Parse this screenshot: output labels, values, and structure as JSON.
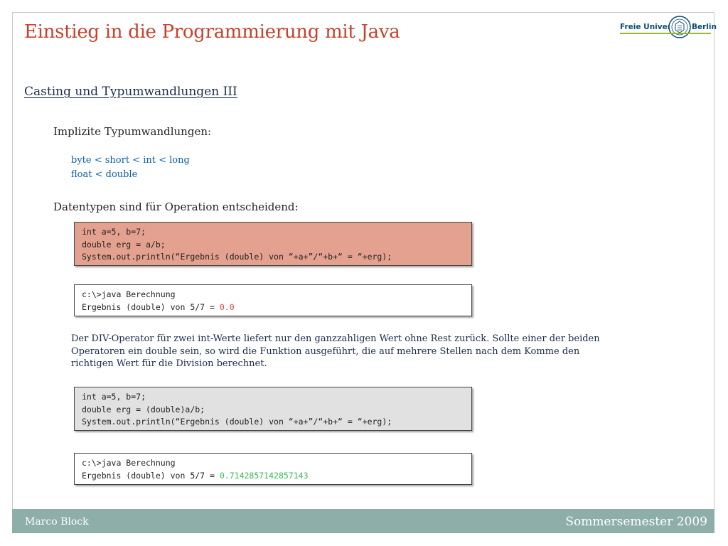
{
  "header": {
    "title": "Einstieg in die Programmierung mit Java",
    "logo_left": "Freie Universität",
    "logo_right": "Berlin"
  },
  "subtitle": "Casting und Typumwandlungen III",
  "section1": {
    "label": "Implizite Typumwandlungen:",
    "lines": [
      "byte < short < int < long",
      "float < double"
    ]
  },
  "section2": {
    "label": "Datentypen sind für Operation entscheidend:"
  },
  "code1": {
    "lines": [
      "int a=5, b=7;",
      "double erg = a/b;",
      "System.out.println(“Ergebnis (double) von “+a+”/“+b+“ = “+erg);"
    ]
  },
  "output1": {
    "line1": "c:\\>java Berechnung",
    "line2_prefix": "Ergebnis (double) von 5/7 = ",
    "line2_value": "0.0"
  },
  "note": "Der DIV-Operator für zwei int-Werte liefert nur den ganzzahligen Wert ohne Rest zurück. Sollte einer der beiden Operatoren ein double sein, so wird die Funktion ausgeführt, die auf mehrere Stellen nach dem Komme den richtigen Wert für die Division berechnet.",
  "code2": {
    "lines": [
      "int a=5, b=7;",
      "double erg = (double)a/b;",
      "System.out.println(“Ergebnis (double) von “+a+”/“+b+“ = “+erg);"
    ]
  },
  "output2": {
    "line1": "c:\\>java Berechnung",
    "line2_prefix": "Ergebnis (double) von 5/7 = ",
    "line2_value": "0.7142857142857143"
  },
  "footer": {
    "author": "Marco Block",
    "semester": "Sommersemester 2009"
  },
  "colors": {
    "title": "#c8402c",
    "code1_bg": "#e4a190",
    "code2_bg": "#e1e1e1",
    "footer_bg": "#8eaeaa",
    "result_bad": "#e0443a",
    "result_good": "#3ab858"
  }
}
